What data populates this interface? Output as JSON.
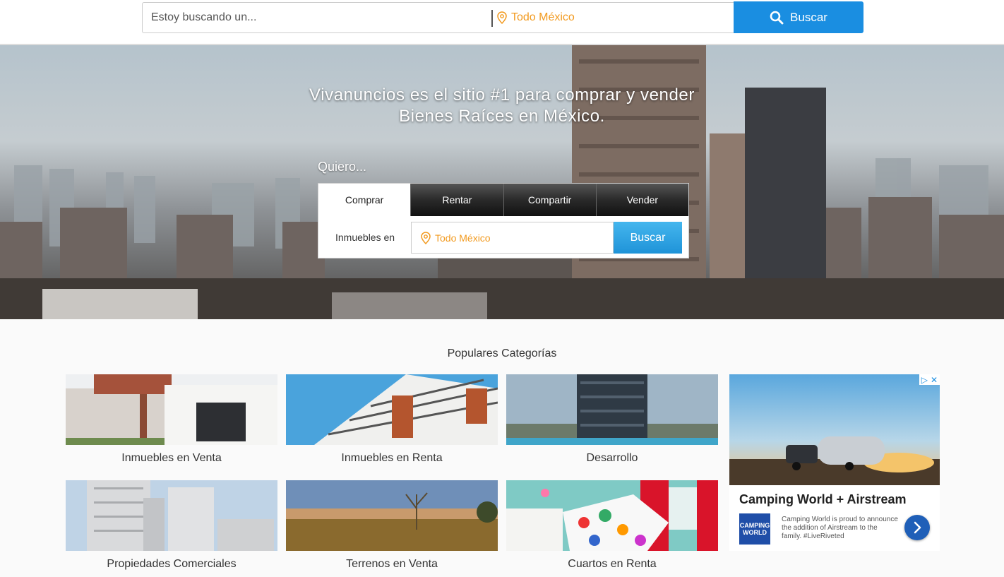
{
  "top_search": {
    "query_placeholder": "Estoy buscando un...",
    "location": "Todo México",
    "button_label": "Buscar"
  },
  "hero": {
    "title": "Vivanuncios es el sitio #1 para comprar y vender Bienes Raíces en México.",
    "quiero_label": "Quiero...",
    "tabs": [
      "Comprar",
      "Rentar",
      "Compartir",
      "Vender"
    ],
    "active_tab": "Comprar",
    "field_label": "Inmuebles en",
    "location": "Todo México",
    "button_label": "Buscar"
  },
  "categories": {
    "title": "Populares Categorías",
    "items": [
      {
        "label": "Inmuebles en Venta"
      },
      {
        "label": "Inmuebles en Renta"
      },
      {
        "label": "Desarrollo"
      },
      {
        "label": "Propiedades Comerciales"
      },
      {
        "label": "Terrenos en Venta"
      },
      {
        "label": "Cuartos en Renta"
      }
    ]
  },
  "ad": {
    "headline": "Camping World + Airstream",
    "logo_text": "CAMPING WORLD",
    "body": "Camping World is proud to announce the addition of Airstream to the family. #LiveRiveted"
  },
  "colors": {
    "accent_blue": "#1a8ee1",
    "location_orange": "#f29a1f"
  }
}
